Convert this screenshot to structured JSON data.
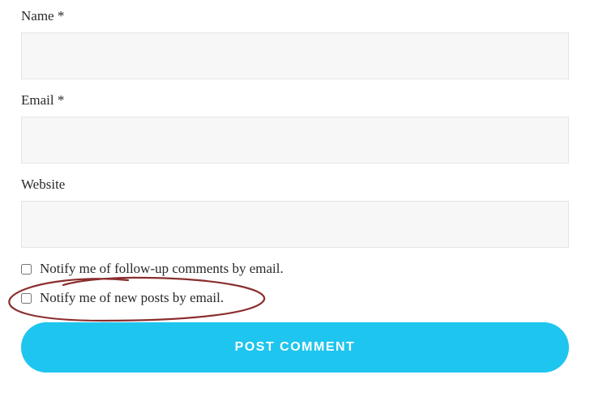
{
  "fields": {
    "name": {
      "label": "Name *"
    },
    "email": {
      "label": "Email *"
    },
    "website": {
      "label": "Website"
    }
  },
  "checkboxes": {
    "followup": {
      "label": "Notify me of follow-up comments by email."
    },
    "newposts": {
      "label": "Notify me of new posts by email."
    }
  },
  "submit": {
    "label": "POST COMMENT"
  }
}
